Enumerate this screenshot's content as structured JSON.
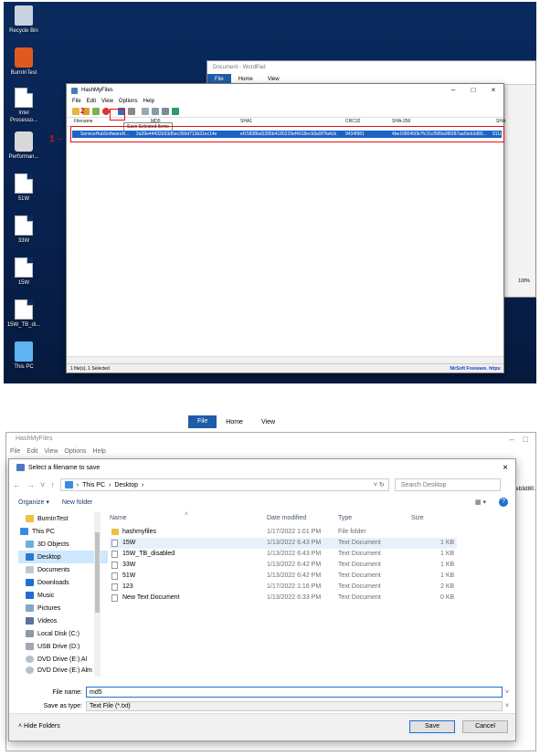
{
  "desktop": {
    "icons": [
      {
        "label": "Recycle Bin"
      },
      {
        "label": "BurnInTest"
      },
      {
        "label": "Intel Processo..."
      },
      {
        "label": "Performan..."
      },
      {
        "label": "51W"
      },
      {
        "label": "33W"
      },
      {
        "label": "15W"
      },
      {
        "label": "15W_TB_di..."
      },
      {
        "label": "This PC"
      }
    ]
  },
  "wordpad": {
    "title": "Document - WordPad",
    "file_tab": "File",
    "tabs": [
      "Home",
      "View"
    ],
    "zoom": "100%"
  },
  "hashmyfiles": {
    "title": "HashMyFiles",
    "menu": [
      "File",
      "Edit",
      "View",
      "Options",
      "Help"
    ],
    "tooltip": "Save Selected Items",
    "columns": {
      "filename": "Filename",
      "md5": "MD5",
      "sha1": "SHA1",
      "crc32": "CRC32",
      "sha256": "SHA-256",
      "sha512": "SHA"
    },
    "row": {
      "filename": "ServiceHubSoftwareR...",
      "md5": "2a39e44432b53d5ec356d713b31ec14e",
      "sha1": "ef15838bd3385b4180229ef4918ecb9a9f7fa4cb",
      "crc32": "9434f981",
      "sha256": "4be1680400b7fc31cf589a9f8387aaf3eb3d80...",
      "sha512": "911c"
    },
    "status": "1 file(s), 1 Selected",
    "nirsoft": "NirSoft Freeware. https:",
    "annotation": "1",
    "annotation2": "2"
  },
  "bottom_bg": {
    "file_tab": "File",
    "tabs": [
      "Home",
      "View"
    ],
    "app_title": "HashMyFiles",
    "menu": [
      "File",
      "Edit",
      "View",
      "Options",
      "Help"
    ],
    "snippet": "eb3d80."
  },
  "save_dialog": {
    "title": "Select a filename to save",
    "breadcrumb": [
      "This PC",
      "Desktop"
    ],
    "search_placeholder": "Search Desktop",
    "organize": "Organize ▾",
    "new_folder": "New folder",
    "nav": [
      {
        "label": "BurnInTest",
        "icon": "folder-icon"
      },
      {
        "label": "This PC",
        "icon": "computer-icon"
      },
      {
        "label": "3D Objects",
        "icon": "cube-icon"
      },
      {
        "label": "Desktop",
        "icon": "desktop-icon"
      },
      {
        "label": "Documents",
        "icon": "document-icon"
      },
      {
        "label": "Downloads",
        "icon": "download-icon"
      },
      {
        "label": "Music",
        "icon": "music-icon"
      },
      {
        "label": "Pictures",
        "icon": "picture-icon"
      },
      {
        "label": "Videos",
        "icon": "video-icon"
      },
      {
        "label": "Local Disk (C:)",
        "icon": "disk-icon"
      },
      {
        "label": "USB Drive (D:)",
        "icon": "usb-icon"
      },
      {
        "label": "DVD Drive (E:) Al",
        "icon": "dvd-icon"
      },
      {
        "label": "DVD Drive (E:) Alm",
        "icon": "dvd-icon"
      }
    ],
    "columns": {
      "name": "Name",
      "date": "Date modified",
      "type": "Type",
      "size": "Size"
    },
    "files": [
      {
        "name": "hashmyfiles",
        "date": "1/17/2022 1:01 PM",
        "type": "File folder",
        "size": "",
        "icon": "folder-icon"
      },
      {
        "name": "15W",
        "date": "1/13/2022 6:43 PM",
        "type": "Text Document",
        "size": "1 KB",
        "icon": "text-file-icon"
      },
      {
        "name": "15W_TB_disabled",
        "date": "1/13/2022 6:43 PM",
        "type": "Text Document",
        "size": "1 KB",
        "icon": "text-file-icon"
      },
      {
        "name": "33W",
        "date": "1/13/2022 6:42 PM",
        "type": "Text Document",
        "size": "1 KB",
        "icon": "text-file-icon"
      },
      {
        "name": "51W",
        "date": "1/13/2022 6:42 PM",
        "type": "Text Document",
        "size": "1 KB",
        "icon": "text-file-icon"
      },
      {
        "name": "123",
        "date": "1/17/2022 1:16 PM",
        "type": "Text Document",
        "size": "2 KB",
        "icon": "text-file-icon"
      },
      {
        "name": "New Text Document",
        "date": "1/13/2022 6:33 PM",
        "type": "Text Document",
        "size": "0 KB",
        "icon": "text-file-icon"
      }
    ],
    "file_name_label": "File name:",
    "file_name_value": "md5",
    "save_type_label": "Save as type:",
    "save_type_value": "Text File (*.txt)",
    "hide_folders": "Hide Folders",
    "save_button": "Save",
    "cancel_button": "Cancel"
  },
  "colors": {
    "accent": "#1d63c6",
    "annotation": "#e0101a",
    "selection": "#cde8ff"
  }
}
